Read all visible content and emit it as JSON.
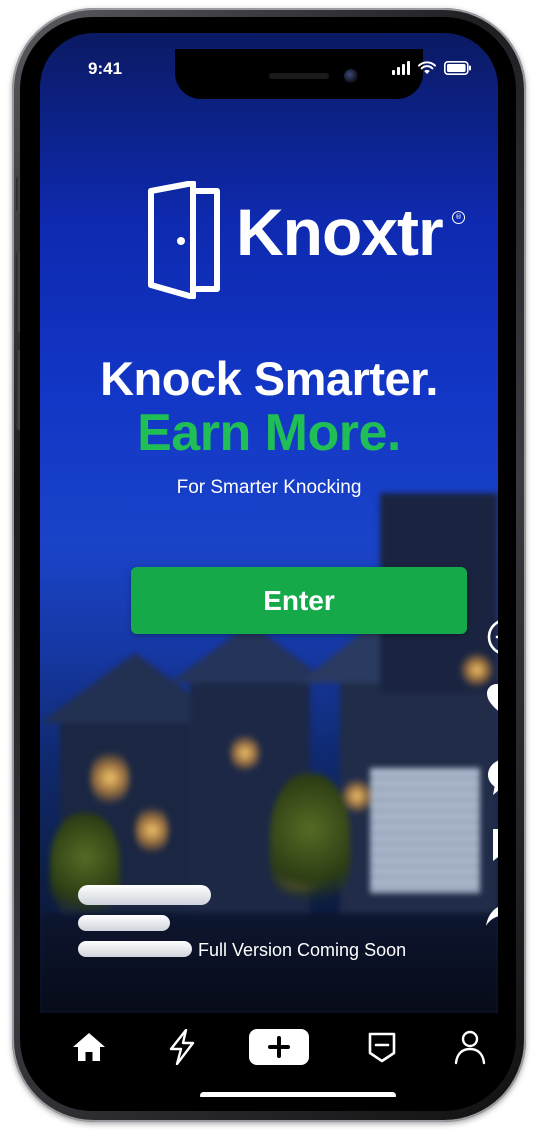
{
  "status_bar": {
    "time": "9:41"
  },
  "brand": {
    "name": "Knoxtr",
    "registered_mark": "®",
    "accent_color": "#1fbf55"
  },
  "hero": {
    "headline_line1": "Knock Smarter.",
    "headline_line2": "Earn More.",
    "tagline": "For Smarter Knocking"
  },
  "cta": {
    "enter_label": "Enter",
    "color": "#16a94a"
  },
  "action_rail": {
    "icons": [
      "plus-circle-icon",
      "heart-icon",
      "comment-icon",
      "bookmark-icon",
      "share-icon"
    ]
  },
  "caption": {
    "text": "Full Version Coming Soon"
  },
  "tab_bar": {
    "icons": [
      "home-icon",
      "lightning-icon",
      "create-icon",
      "inbox-icon",
      "profile-icon"
    ]
  }
}
